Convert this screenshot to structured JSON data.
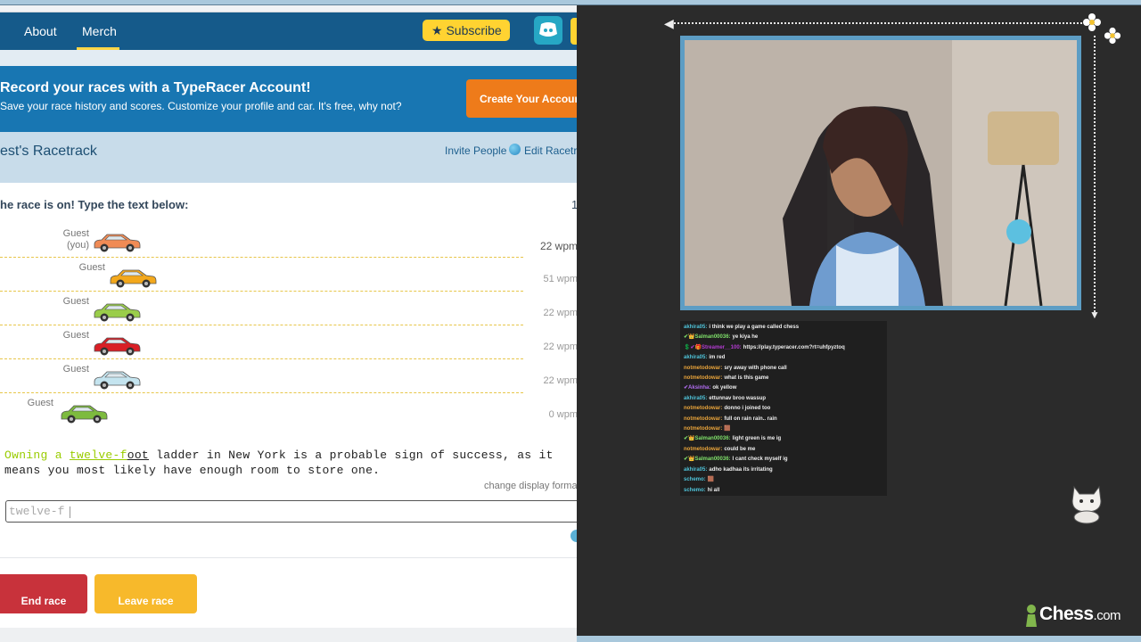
{
  "typeracer": {
    "nav": {
      "about": "About",
      "merch": "Merch",
      "subscribe": "★ Subscribe"
    },
    "banner": {
      "title": "Record your races with a TypeRacer Account!",
      "subtitle": "Save your race history and scores. Customize your profile and car. It's free, why not?",
      "button": "Create Your Account"
    },
    "racetrack": {
      "title": "est's Racetrack",
      "invite": "Invite People",
      "edit": "Edit Racetr"
    },
    "race": {
      "status": "he race is on! Type the text below:",
      "timer": "1",
      "racers": [
        {
          "name": "Guest",
          "name2": "(you)",
          "wpm": "22 wpm",
          "color": "#f08b55",
          "progress": 0.23
        },
        {
          "name": "Guest",
          "name2": "",
          "wpm": "51 wpm",
          "color": "#f3a81c",
          "progress": 0.25
        },
        {
          "name": "Guest",
          "name2": "",
          "wpm": "22 wpm",
          "color": "#9acd4a",
          "progress": 0.23
        },
        {
          "name": "Guest",
          "name2": "",
          "wpm": "22 wpm",
          "color": "#d91f26",
          "progress": 0.23
        },
        {
          "name": "Guest",
          "name2": "",
          "wpm": "22 wpm",
          "color": "#c4e4ef",
          "progress": 0.23
        },
        {
          "name": "Guest",
          "name2": "",
          "wpm": "0 wpm",
          "color": "#7dbb3e",
          "progress": 0.12
        }
      ]
    },
    "passage": {
      "typed": "Owning a ",
      "current_typed": "twelve-f",
      "current_rest": "oot",
      "remaining": " ladder in New York is a probable sign of success, as it means you most likely have enough room to store one."
    },
    "change_display": "change display forma",
    "input_value": "twelve-f",
    "buttons": {
      "end_race": "End race",
      "leave_race": "Leave race"
    }
  },
  "chat": {
    "messages": [
      {
        "user": "akhira05:",
        "color": "#4fc3d9",
        "text": "i think we play a game called chess"
      },
      {
        "user": "✔👑Salman00036:",
        "color": "#7fe06a",
        "text": "ye kiya he"
      },
      {
        "user": "💲✔🎁Streamer__100:",
        "color": "#b33bd1",
        "text": "https://play.typeracer.com?rt=uhfpyztoq"
      },
      {
        "user": "akhira05:",
        "color": "#4fc3d9",
        "text": "im red"
      },
      {
        "user": "notmetodowar:",
        "color": "#e8a33a",
        "text": "sry away with phone call"
      },
      {
        "user": "notmetodowar:",
        "color": "#e8a33a",
        "text": "what is this game"
      },
      {
        "user": "✔Aksinha:",
        "color": "#b06cf0",
        "text": "ok yellow"
      },
      {
        "user": "akhira05:",
        "color": "#4fc3d9",
        "text": "ettunnav broo wassup"
      },
      {
        "user": "notmetodowar:",
        "color": "#e8a33a",
        "text": "donno i joined too"
      },
      {
        "user": "notmetodowar:",
        "color": "#e8a33a",
        "text": "full on rain rain.. rain"
      },
      {
        "user": "notmetodowar:",
        "color": "#e8a33a",
        "text": "🟫"
      },
      {
        "user": "✔👑Salman00036:",
        "color": "#7fe06a",
        "text": "light green is me ig"
      },
      {
        "user": "notmetodowar:",
        "color": "#e8a33a",
        "text": "could be me"
      },
      {
        "user": "✔👑Salman00036:",
        "color": "#7fe06a",
        "text": "I cant check myself ig"
      },
      {
        "user": "akhira05:",
        "color": "#4fc3d9",
        "text": "adho kadhaa its irritating"
      },
      {
        "user": "schemo:",
        "color": "#4fc3d9",
        "text": "🟫"
      },
      {
        "user": "schemo:",
        "color": "#4fc3d9",
        "text": "hi all"
      }
    ]
  },
  "branding": {
    "chesscom": "Chess",
    "chesscom_suffix": ".com"
  },
  "colors": {
    "nav_blue": "#155a8a",
    "banner_blue": "#1876b2",
    "accent_yellow": "#ffd331",
    "create_orange": "#ee7b1a",
    "end_red": "#c8323b",
    "leave_orange": "#f7b92b",
    "typed_green": "#99cc00"
  }
}
